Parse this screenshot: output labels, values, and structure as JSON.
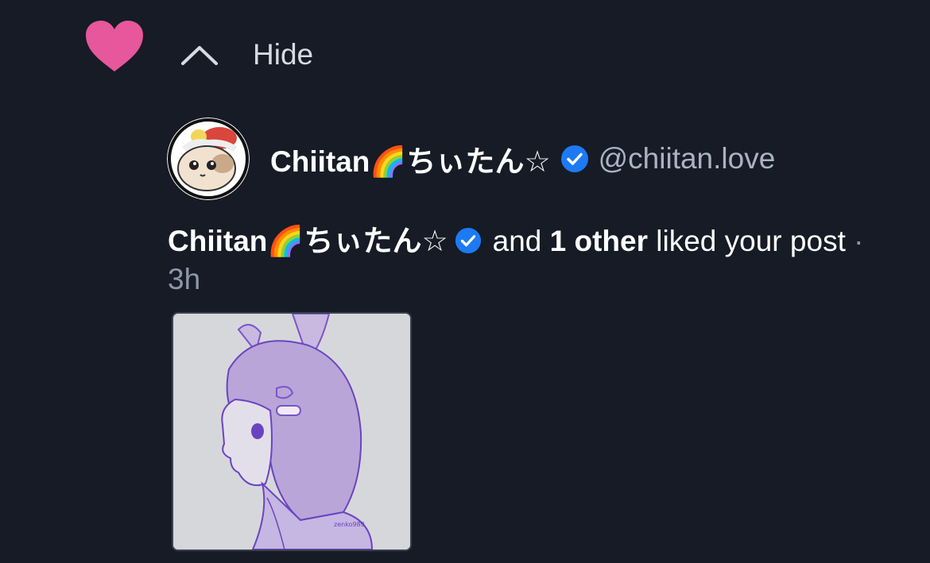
{
  "notification": {
    "hide_label": "Hide",
    "colors": {
      "background": "#161b26",
      "heart": "#e6579c",
      "verified": "#1d7af2",
      "handle": "#a9b3c4"
    }
  },
  "user": {
    "display_name": "Chiitan🌈ちぃたん☆",
    "handle": "@chiitan.love",
    "verified": true
  },
  "message": {
    "actor": "Chiitan🌈ちぃたん☆",
    "and_text": "and",
    "others": "1 other",
    "action": "liked your post",
    "separator": "·",
    "time": "3h"
  },
  "post": {
    "image_signature": "zenko989"
  }
}
